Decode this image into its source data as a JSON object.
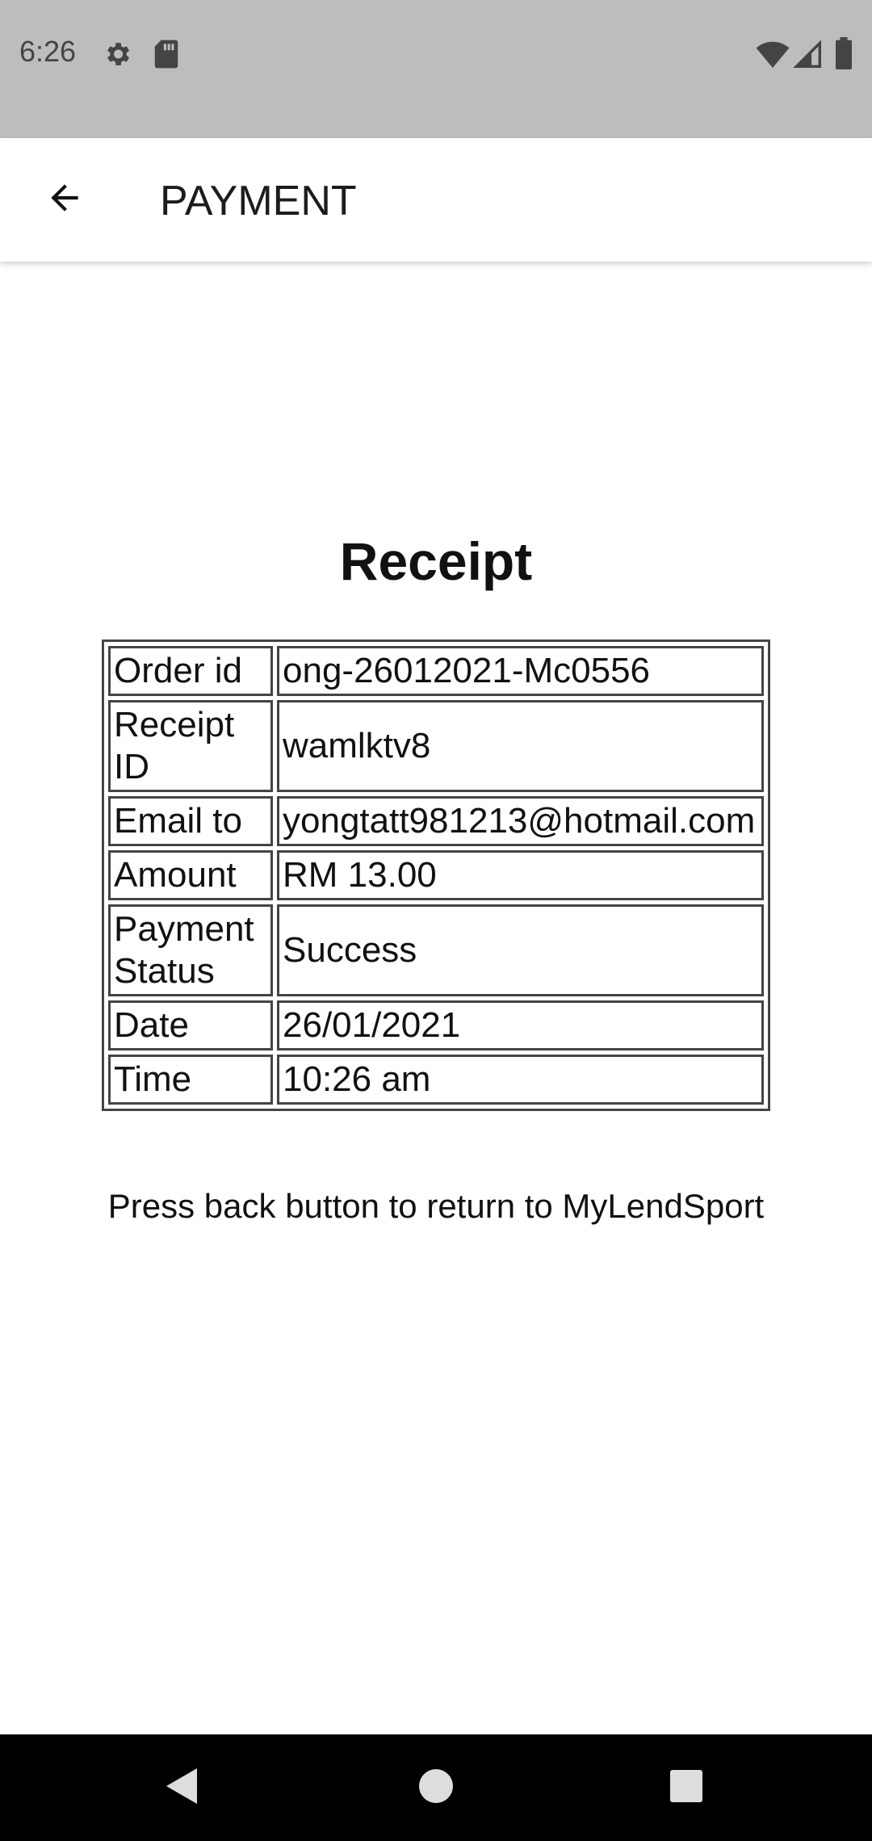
{
  "status_bar": {
    "time": "6:26",
    "icons": [
      "settings-icon",
      "sd-card-icon",
      "wifi-icon",
      "signal-icon",
      "battery-icon"
    ]
  },
  "app_bar": {
    "title": "PAYMENT",
    "back_icon": "arrow-back-icon"
  },
  "receipt": {
    "title": "Receipt",
    "rows": [
      {
        "label": "Order id",
        "value": "ong-26012021-Mc0556"
      },
      {
        "label": "Receipt ID",
        "value": "wamlktv8"
      },
      {
        "label": "Email to",
        "value": "yongtatt981213@hotmail.com"
      },
      {
        "label": "Amount",
        "value": "RM 13.00"
      },
      {
        "label": "Payment Status",
        "value": "Success"
      },
      {
        "label": "Date",
        "value": "26/01/2021"
      },
      {
        "label": "Time",
        "value": "10:26 am"
      }
    ]
  },
  "note": "Press back button to return to MyLendSport",
  "nav_bar": {
    "icons": [
      "nav-back-icon",
      "nav-home-icon",
      "nav-recents-icon"
    ]
  },
  "colors": {
    "status_bar_bg": "#bdbdbd",
    "nav_bar_bg": "#000000",
    "table_border": "#444444"
  }
}
